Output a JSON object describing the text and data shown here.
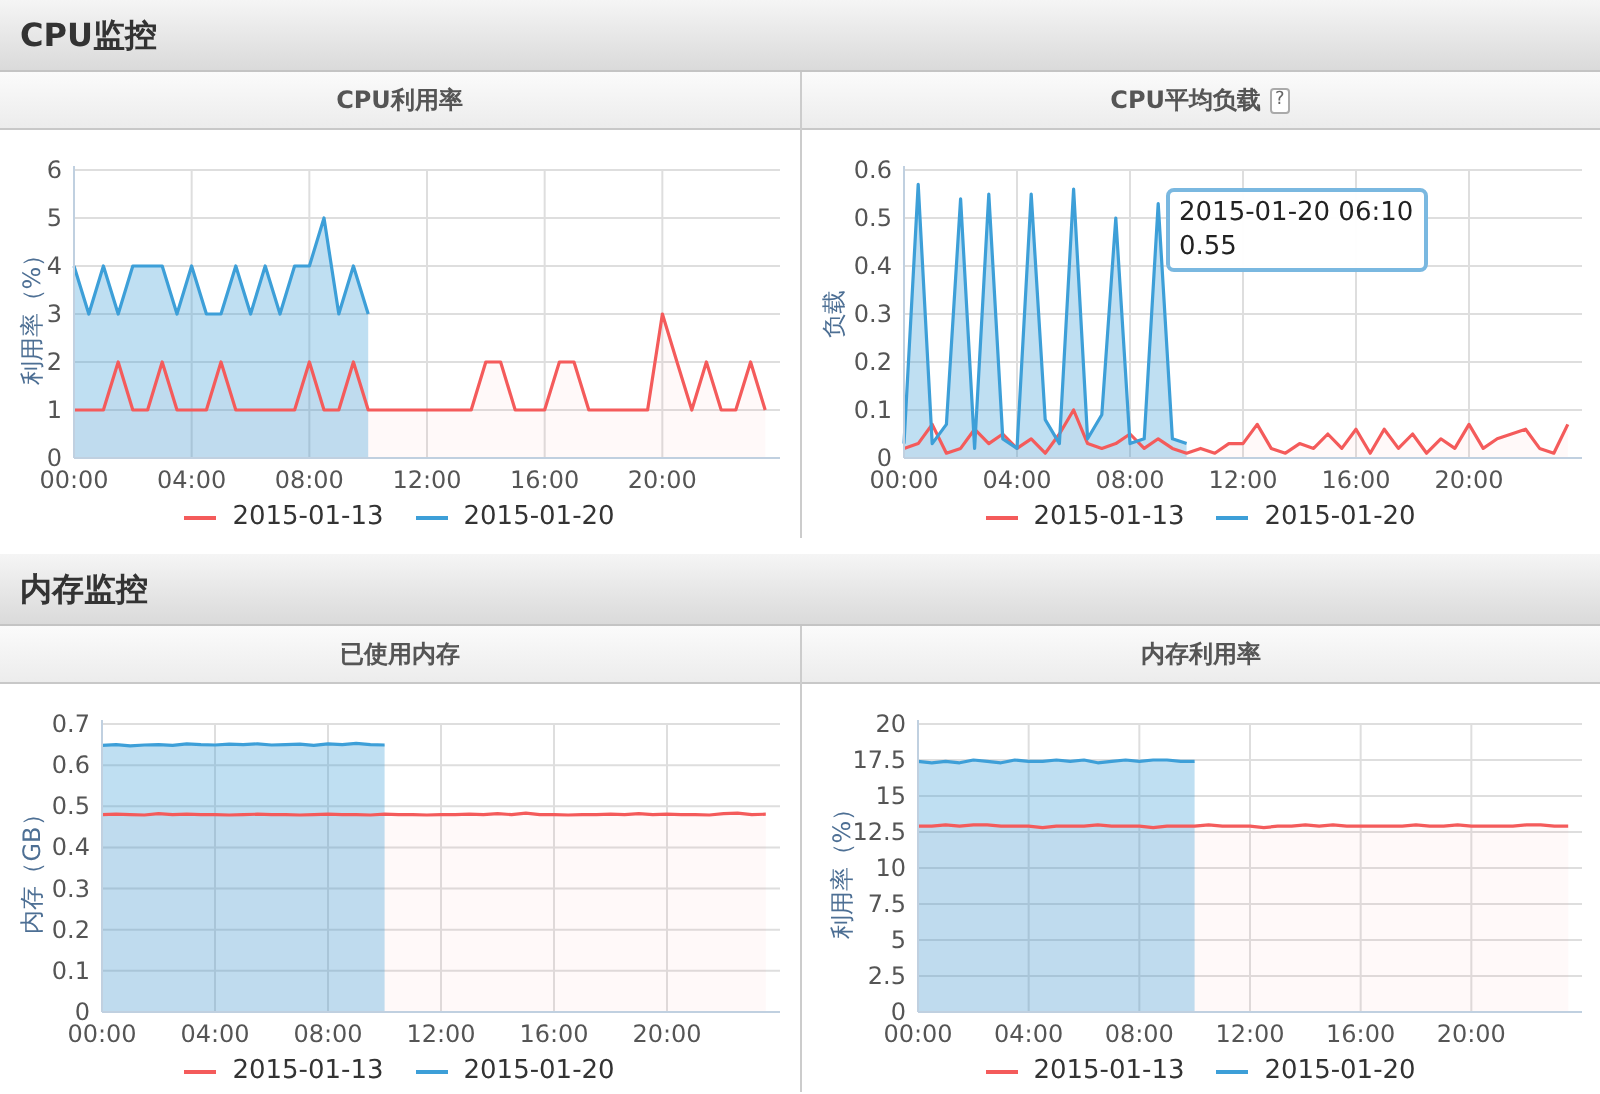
{
  "sections": [
    {
      "title": "CPU监控",
      "panels": [
        {
          "title": "CPU利用率",
          "chart_data": {
            "type": "area",
            "grid": true,
            "legend": true,
            "ylabel": "利用率（%）",
            "xlim": [
              0,
              24
            ],
            "ylim": [
              0,
              6
            ],
            "x": [
              0,
              0.5,
              1,
              1.5,
              2,
              2.5,
              3,
              3.5,
              4,
              4.5,
              5,
              5.5,
              6,
              6.5,
              7,
              7.5,
              8,
              8.5,
              9,
              9.5,
              10,
              10.5,
              11,
              11.5,
              12,
              12.5,
              13,
              13.5,
              14,
              14.5,
              15,
              15.5,
              16,
              16.5,
              17,
              17.5,
              18,
              18.5,
              19,
              19.5,
              20,
              20.5,
              21,
              21.5,
              22,
              22.5,
              23,
              23.5
            ],
            "xticks": [
              {
                "value": 0,
                "label": "00:00"
              },
              {
                "value": 4,
                "label": "04:00"
              },
              {
                "value": 8,
                "label": "08:00"
              },
              {
                "value": 12,
                "label": "12:00"
              },
              {
                "value": 16,
                "label": "16:00"
              },
              {
                "value": 20,
                "label": "20:00"
              }
            ],
            "yticks": [
              0,
              1,
              2,
              3,
              4,
              5,
              6
            ],
            "series": [
              {
                "name": "2015-01-13",
                "color": "#f45b5b",
                "values": [
                  1,
                  1,
                  1,
                  2,
                  1,
                  1,
                  2,
                  1,
                  1,
                  1,
                  2,
                  1,
                  1,
                  1,
                  1,
                  1,
                  2,
                  1,
                  1,
                  2,
                  1,
                  1,
                  1,
                  1,
                  1,
                  1,
                  1,
                  1,
                  2,
                  2,
                  1,
                  1,
                  1,
                  2,
                  2,
                  1,
                  1,
                  1,
                  1,
                  1,
                  3,
                  2,
                  1,
                  2,
                  1,
                  1,
                  2,
                  1
                ]
              },
              {
                "name": "2015-01-20",
                "color": "#3d9fd8",
                "values": [
                  4,
                  3,
                  4,
                  3,
                  4,
                  4,
                  4,
                  3,
                  4,
                  3,
                  3,
                  4,
                  3,
                  4,
                  3,
                  4,
                  4,
                  5,
                  3,
                  4,
                  3,
                  null,
                  null,
                  null,
                  null,
                  null,
                  null,
                  null,
                  null,
                  null,
                  null,
                  null,
                  null,
                  null,
                  null,
                  null,
                  null,
                  null,
                  null,
                  null,
                  null,
                  null,
                  null,
                  null,
                  null,
                  null,
                  null,
                  null
                ]
              }
            ]
          }
        },
        {
          "title": "CPU平均负载",
          "help": "?",
          "tooltip": {
            "title": "2015-01-20 06:10",
            "value": "0.55"
          },
          "chart_data": {
            "type": "area",
            "grid": true,
            "legend": true,
            "ylabel": "负载",
            "xlim": [
              0,
              24
            ],
            "ylim": [
              0,
              0.6
            ],
            "x": [
              0,
              0.5,
              1,
              1.5,
              2,
              2.5,
              3,
              3.5,
              4,
              4.5,
              5,
              5.5,
              6,
              6.5,
              7,
              7.5,
              8,
              8.5,
              9,
              9.5,
              10,
              10.5,
              11,
              11.5,
              12,
              12.5,
              13,
              13.5,
              14,
              14.5,
              15,
              15.5,
              16,
              16.5,
              17,
              17.5,
              18,
              18.5,
              19,
              19.5,
              20,
              20.5,
              21,
              21.5,
              22,
              22.5,
              23,
              23.5
            ],
            "xticks": [
              {
                "value": 0,
                "label": "00:00"
              },
              {
                "value": 4,
                "label": "04:00"
              },
              {
                "value": 8,
                "label": "08:00"
              },
              {
                "value": 12,
                "label": "12:00"
              },
              {
                "value": 16,
                "label": "16:00"
              },
              {
                "value": 20,
                "label": "20:00"
              }
            ],
            "yticks": [
              0,
              0.1,
              0.2,
              0.3,
              0.4,
              0.5,
              0.6
            ],
            "series": [
              {
                "name": "2015-01-13",
                "color": "#f45b5b",
                "values": [
                  0.02,
                  0.03,
                  0.07,
                  0.01,
                  0.02,
                  0.06,
                  0.03,
                  0.05,
                  0.02,
                  0.04,
                  0.01,
                  0.05,
                  0.1,
                  0.03,
                  0.02,
                  0.03,
                  0.05,
                  0.02,
                  0.04,
                  0.02,
                  0.01,
                  0.02,
                  0.01,
                  0.03,
                  0.03,
                  0.07,
                  0.02,
                  0.01,
                  0.03,
                  0.02,
                  0.05,
                  0.02,
                  0.06,
                  0.01,
                  0.06,
                  0.02,
                  0.05,
                  0.01,
                  0.04,
                  0.02,
                  0.07,
                  0.02,
                  0.04,
                  0.05,
                  0.06,
                  0.02,
                  0.01,
                  0.07
                ]
              },
              {
                "name": "2015-01-20",
                "color": "#3d9fd8",
                "values": [
                  0.03,
                  0.57,
                  0.03,
                  0.07,
                  0.54,
                  0.02,
                  0.55,
                  0.04,
                  0.02,
                  0.55,
                  0.08,
                  0.03,
                  0.56,
                  0.04,
                  0.09,
                  0.5,
                  0.03,
                  0.04,
                  0.53,
                  0.04,
                  0.03,
                  null,
                  null,
                  null,
                  null,
                  null,
                  null,
                  null,
                  null,
                  null,
                  null,
                  null,
                  null,
                  null,
                  null,
                  null,
                  null,
                  null,
                  null,
                  null,
                  null,
                  null,
                  null,
                  null,
                  null,
                  null,
                  null,
                  null
                ]
              }
            ]
          }
        }
      ]
    },
    {
      "title": "内存监控",
      "panels": [
        {
          "title": "已使用内存",
          "chart_data": {
            "type": "area",
            "grid": true,
            "legend": true,
            "ylabel": "内存（GB）",
            "xlim": [
              0,
              24
            ],
            "ylim": [
              0,
              0.7
            ],
            "x": [
              0,
              0.5,
              1,
              1.5,
              2,
              2.5,
              3,
              3.5,
              4,
              4.5,
              5,
              5.5,
              6,
              6.5,
              7,
              7.5,
              8,
              8.5,
              9,
              9.5,
              10,
              10.5,
              11,
              11.5,
              12,
              12.5,
              13,
              13.5,
              14,
              14.5,
              15,
              15.5,
              16,
              16.5,
              17,
              17.5,
              18,
              18.5,
              19,
              19.5,
              20,
              20.5,
              21,
              21.5,
              22,
              22.5,
              23,
              23.5
            ],
            "xticks": [
              {
                "value": 0,
                "label": "00:00"
              },
              {
                "value": 4,
                "label": "04:00"
              },
              {
                "value": 8,
                "label": "08:00"
              },
              {
                "value": 12,
                "label": "12:00"
              },
              {
                "value": 16,
                "label": "16:00"
              },
              {
                "value": 20,
                "label": "20:00"
              }
            ],
            "yticks": [
              0,
              0.1,
              0.2,
              0.3,
              0.4,
              0.5,
              0.6,
              0.7
            ],
            "series": [
              {
                "name": "2015-01-13",
                "color": "#f45b5b",
                "values": [
                  0.48,
                  0.481,
                  0.48,
                  0.479,
                  0.482,
                  0.48,
                  0.481,
                  0.48,
                  0.48,
                  0.479,
                  0.48,
                  0.481,
                  0.48,
                  0.48,
                  0.479,
                  0.48,
                  0.481,
                  0.48,
                  0.48,
                  0.479,
                  0.481,
                  0.48,
                  0.48,
                  0.479,
                  0.48,
                  0.48,
                  0.481,
                  0.48,
                  0.482,
                  0.48,
                  0.483,
                  0.48,
                  0.48,
                  0.479,
                  0.48,
                  0.48,
                  0.481,
                  0.48,
                  0.482,
                  0.48,
                  0.481,
                  0.48,
                  0.48,
                  0.479,
                  0.482,
                  0.483,
                  0.48,
                  0.481
                ]
              },
              {
                "name": "2015-01-20",
                "color": "#3d9fd8",
                "values": [
                  0.648,
                  0.65,
                  0.647,
                  0.649,
                  0.65,
                  0.648,
                  0.652,
                  0.65,
                  0.649,
                  0.651,
                  0.65,
                  0.652,
                  0.649,
                  0.65,
                  0.651,
                  0.648,
                  0.652,
                  0.65,
                  0.653,
                  0.65,
                  0.649,
                  null,
                  null,
                  null,
                  null,
                  null,
                  null,
                  null,
                  null,
                  null,
                  null,
                  null,
                  null,
                  null,
                  null,
                  null,
                  null,
                  null,
                  null,
                  null,
                  null,
                  null,
                  null,
                  null,
                  null,
                  null,
                  null,
                  null
                ]
              }
            ]
          }
        },
        {
          "title": "内存利用率",
          "chart_data": {
            "type": "area",
            "grid": true,
            "legend": true,
            "ylabel": "利用率（%）",
            "xlim": [
              0,
              24
            ],
            "ylim": [
              0,
              20
            ],
            "x": [
              0,
              0.5,
              1,
              1.5,
              2,
              2.5,
              3,
              3.5,
              4,
              4.5,
              5,
              5.5,
              6,
              6.5,
              7,
              7.5,
              8,
              8.5,
              9,
              9.5,
              10,
              10.5,
              11,
              11.5,
              12,
              12.5,
              13,
              13.5,
              14,
              14.5,
              15,
              15.5,
              16,
              16.5,
              17,
              17.5,
              18,
              18.5,
              19,
              19.5,
              20,
              20.5,
              21,
              21.5,
              22,
              22.5,
              23,
              23.5
            ],
            "xticks": [
              {
                "value": 0,
                "label": "00:00"
              },
              {
                "value": 4,
                "label": "04:00"
              },
              {
                "value": 8,
                "label": "08:00"
              },
              {
                "value": 12,
                "label": "12:00"
              },
              {
                "value": 16,
                "label": "16:00"
              },
              {
                "value": 20,
                "label": "20:00"
              }
            ],
            "yticks": [
              0,
              2.5,
              5,
              7.5,
              10,
              12.5,
              15,
              17.5,
              20
            ],
            "series": [
              {
                "name": "2015-01-13",
                "color": "#f45b5b",
                "values": [
                  12.9,
                  12.9,
                  13,
                  12.9,
                  13,
                  13,
                  12.9,
                  12.9,
                  12.9,
                  12.8,
                  12.9,
                  12.9,
                  12.9,
                  13,
                  12.9,
                  12.9,
                  12.9,
                  12.8,
                  12.9,
                  12.9,
                  12.9,
                  13,
                  12.9,
                  12.9,
                  12.9,
                  12.8,
                  12.9,
                  12.9,
                  13,
                  12.9,
                  13,
                  12.9,
                  12.9,
                  12.9,
                  12.9,
                  12.9,
                  13,
                  12.9,
                  12.9,
                  13,
                  12.9,
                  12.9,
                  12.9,
                  12.9,
                  13,
                  13,
                  12.9,
                  12.9
                ]
              },
              {
                "name": "2015-01-20",
                "color": "#3d9fd8",
                "values": [
                  17.4,
                  17.3,
                  17.4,
                  17.3,
                  17.5,
                  17.4,
                  17.3,
                  17.5,
                  17.4,
                  17.4,
                  17.5,
                  17.4,
                  17.5,
                  17.3,
                  17.4,
                  17.5,
                  17.4,
                  17.5,
                  17.5,
                  17.4,
                  17.4,
                  null,
                  null,
                  null,
                  null,
                  null,
                  null,
                  null,
                  null,
                  null,
                  null,
                  null,
                  null,
                  null,
                  null,
                  null,
                  null,
                  null,
                  null,
                  null,
                  null,
                  null,
                  null,
                  null,
                  null,
                  null,
                  null,
                  null
                ]
              }
            ]
          }
        }
      ]
    }
  ]
}
